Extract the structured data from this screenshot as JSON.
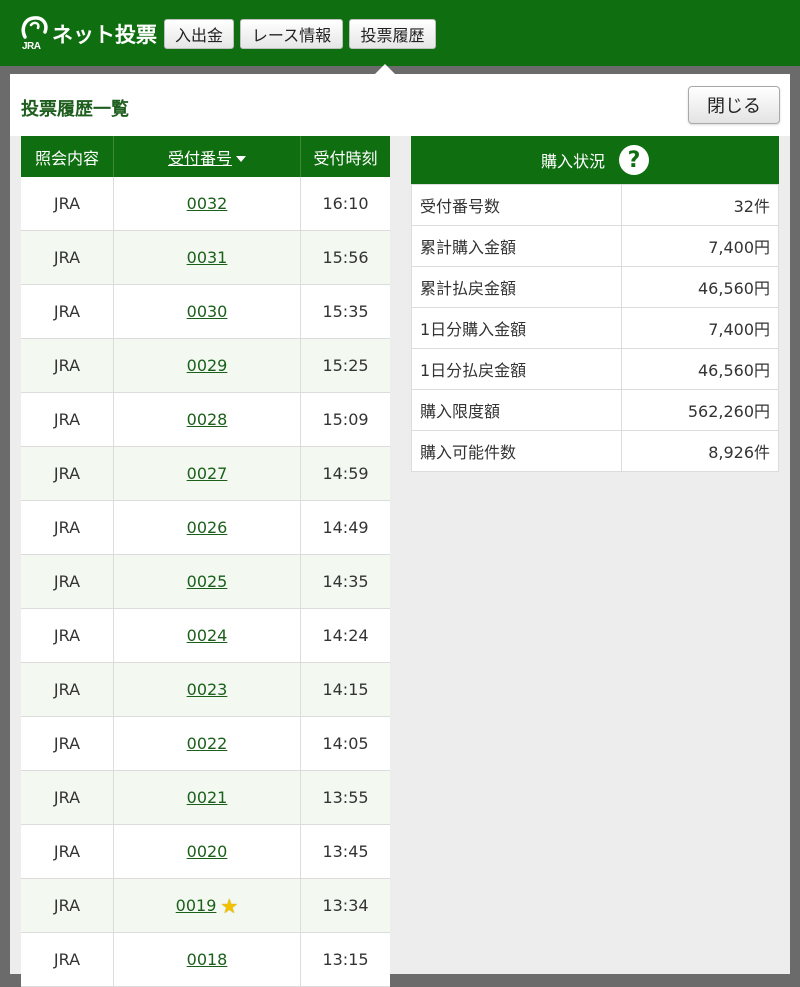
{
  "header": {
    "logo_jra": "JRA",
    "logo_text": "ネット投票",
    "nav": [
      "入出金",
      "レース情報",
      "投票履歴"
    ]
  },
  "page": {
    "title": "投票履歴一覧",
    "close_label": "閉じる"
  },
  "history": {
    "columns": [
      "照会内容",
      "受付番号",
      "受付時刻"
    ],
    "rows": [
      {
        "type": "JRA",
        "number": "0032",
        "time": "16:10"
      },
      {
        "type": "JRA",
        "number": "0031",
        "time": "15:56"
      },
      {
        "type": "JRA",
        "number": "0030",
        "time": "15:35"
      },
      {
        "type": "JRA",
        "number": "0029",
        "time": "15:25"
      },
      {
        "type": "JRA",
        "number": "0028",
        "time": "15:09"
      },
      {
        "type": "JRA",
        "number": "0027",
        "time": "14:59"
      },
      {
        "type": "JRA",
        "number": "0026",
        "time": "14:49"
      },
      {
        "type": "JRA",
        "number": "0025",
        "time": "14:35"
      },
      {
        "type": "JRA",
        "number": "0024",
        "time": "14:24"
      },
      {
        "type": "JRA",
        "number": "0023",
        "time": "14:15"
      },
      {
        "type": "JRA",
        "number": "0022",
        "time": "14:05"
      },
      {
        "type": "JRA",
        "number": "0021",
        "time": "13:55"
      },
      {
        "type": "JRA",
        "number": "0020",
        "time": "13:45"
      },
      {
        "type": "JRA",
        "number": "0019",
        "time": "13:34",
        "starred": true
      },
      {
        "type": "JRA",
        "number": "0018",
        "time": "13:15"
      }
    ]
  },
  "status": {
    "title": "購入状況",
    "help_icon": "question-circle-icon",
    "rows": [
      {
        "label": "受付番号数",
        "value": "32件"
      },
      {
        "label": "累計購入金額",
        "value": "7,400円"
      },
      {
        "label": "累計払戻金額",
        "value": "46,560円"
      },
      {
        "label": "1日分購入金額",
        "value": "7,400円"
      },
      {
        "label": "1日分払戻金額",
        "value": "46,560円"
      },
      {
        "label": "購入限度額",
        "value": "562,260円"
      },
      {
        "label": "購入可能件数",
        "value": "8,926件"
      }
    ]
  },
  "colors": {
    "brand_green": "#0f6e10",
    "link_green": "#1a5f1a",
    "star": "#f2c200"
  }
}
